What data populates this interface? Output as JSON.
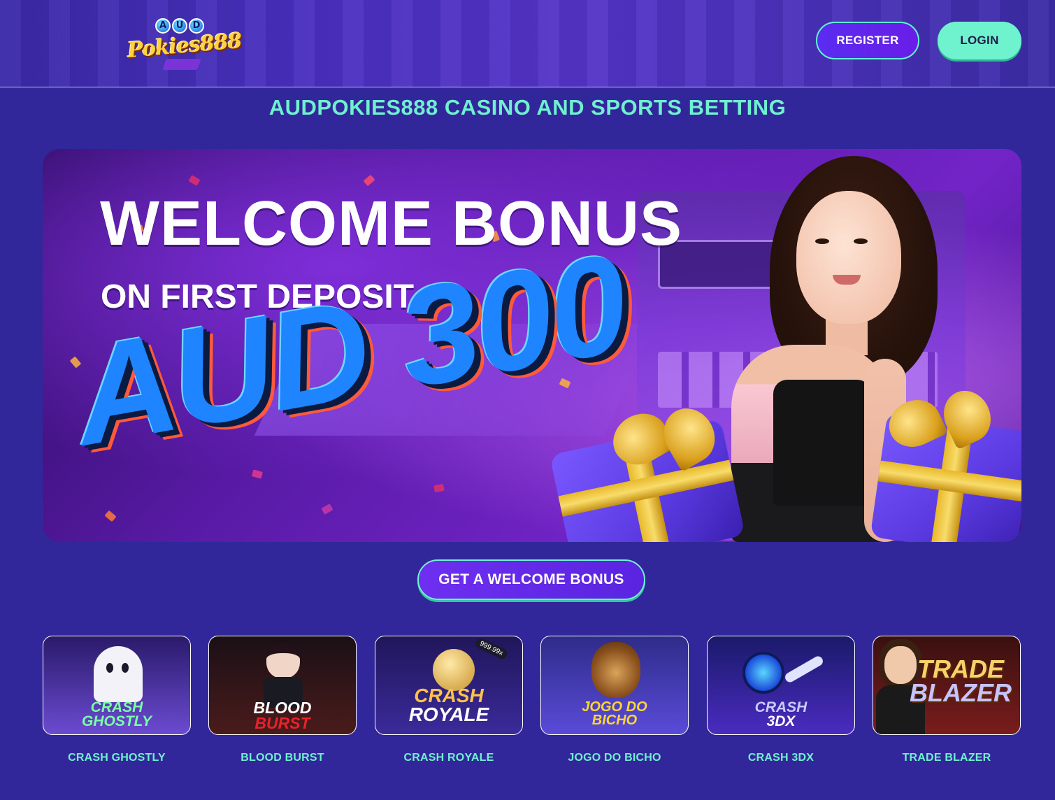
{
  "header": {
    "logo": {
      "aud_letters": [
        "A",
        "U",
        "D"
      ],
      "brand": "Pokies888"
    },
    "register_label": "REGISTER",
    "login_label": "LOGIN"
  },
  "page_title": "AUDPOKIES888 CASINO AND SPORTS BETTING",
  "banner": {
    "title": "WELCOME BONUS",
    "subtitle": "ON FIRST DEPOSIT",
    "amount": "AUD 300"
  },
  "cta_label": "GET A WELCOME BONUS",
  "games": [
    {
      "label": "CRASH GHOSTLY",
      "thumb_lines": [
        "CRASH",
        "GHOSTLY"
      ],
      "thumb_colors": [
        "#2a1a6a",
        "#6b4bd1"
      ],
      "title_color": "#7dffa8"
    },
    {
      "label": "BLOOD BURST",
      "thumb_lines": [
        "BLOOD",
        "BURST"
      ],
      "thumb_colors": [
        "#1a1016",
        "#4a1b1b"
      ],
      "title_color": "#ffffff"
    },
    {
      "label": "CRASH ROYALE",
      "thumb_lines": [
        "CRASH",
        "ROYALE"
      ],
      "thumb_colors": [
        "#20165a",
        "#3b2a9a"
      ],
      "title_color": "#ffc24a",
      "badge": "999.99x"
    },
    {
      "label": "JOGO DO BICHO",
      "thumb_lines": [
        "JOGO DO",
        "BICHO"
      ],
      "thumb_colors": [
        "#2e2c8a",
        "#5a4bd8"
      ],
      "title_color": "#ffd53a"
    },
    {
      "label": "CRASH 3DX",
      "thumb_lines": [
        "CRASH",
        "3DX"
      ],
      "thumb_colors": [
        "#1a1a6a",
        "#4a2bc0"
      ],
      "title_color": "#c7ccff"
    },
    {
      "label": "TRADE BLAZER",
      "thumb_lines": [
        "TRADE",
        "BLAZER"
      ],
      "thumb_colors": [
        "#3a1010",
        "#7a1c1c"
      ],
      "title_color": "#f6d26a"
    }
  ],
  "colors": {
    "background": "#32279a",
    "accent_mint": "#6ff0cf",
    "button_purple": "#5a2cf0",
    "amount_blue": "#1e84ff"
  }
}
